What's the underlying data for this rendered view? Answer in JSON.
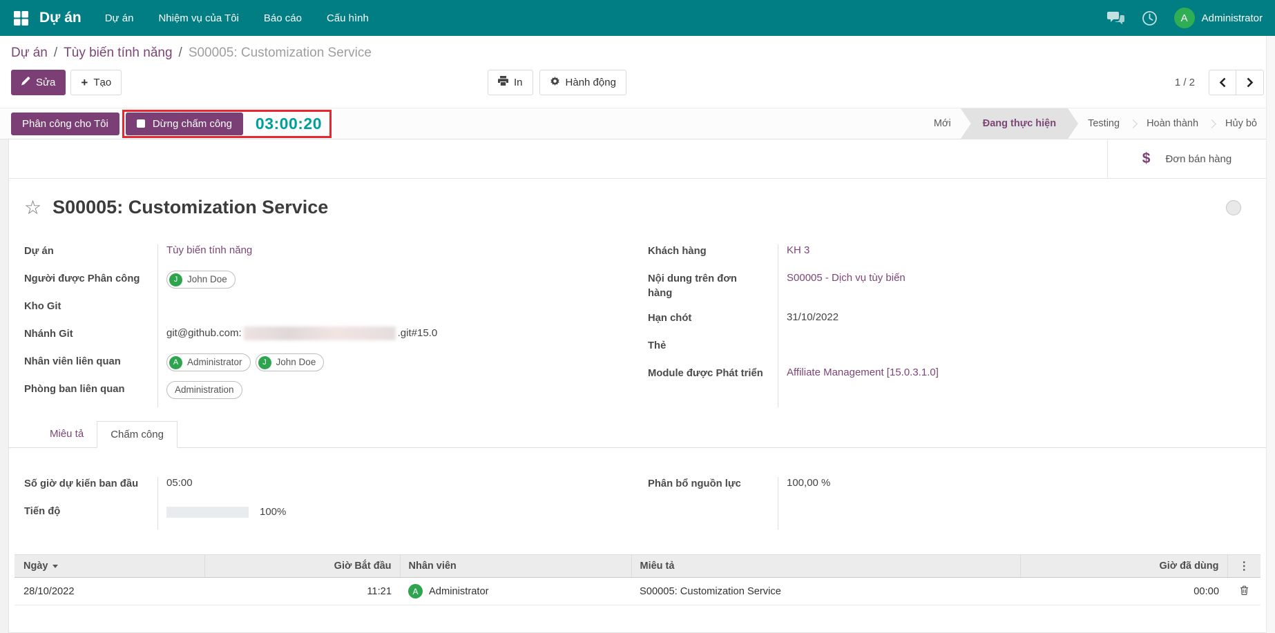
{
  "navbar": {
    "brand": "Dự án",
    "menus": [
      "Dự án",
      "Nhiệm vụ của Tôi",
      "Báo cáo",
      "Cấu hình"
    ],
    "user": {
      "initial": "A",
      "name": "Administrator"
    }
  },
  "breadcrumb": {
    "links": [
      "Dự án",
      "Tùy biến tính năng"
    ],
    "current": "S00005: Customization Service"
  },
  "control_panel": {
    "edit": "Sửa",
    "create": "Tạo",
    "print": "In",
    "action": "Hành động",
    "pager": "1 / 2"
  },
  "statusbar": {
    "assign_me": "Phân công cho Tôi",
    "stop_timer": "Dừng chấm công",
    "timer": "03:00:20",
    "stages": [
      {
        "label": "Mới",
        "active": false
      },
      {
        "label": "Đang thực hiện",
        "active": true
      },
      {
        "label": "Testing",
        "active": false
      },
      {
        "label": "Hoàn thành",
        "active": false
      },
      {
        "label": "Hủy bỏ",
        "active": false
      }
    ]
  },
  "smart_button": {
    "icon": "$",
    "label": "Đơn bán hàng"
  },
  "sheet": {
    "title": "S00005: Customization Service",
    "fields_left": [
      {
        "label": "Dự án",
        "type": "link",
        "value": "Tùy biến tính năng"
      },
      {
        "label": "Người được Phân công",
        "type": "tags",
        "tags": [
          {
            "initial": "J",
            "name": "John Doe"
          }
        ]
      },
      {
        "label": "Kho Git",
        "type": "redacted"
      },
      {
        "label": "Nhánh Git",
        "type": "redacted_inline",
        "prefix": "git@github.com:",
        "suffix": ".git#15.0"
      },
      {
        "label": "Nhân viên liên quan",
        "type": "tags",
        "tags": [
          {
            "initial": "A",
            "name": "Administrator"
          },
          {
            "initial": "J",
            "name": "John Doe"
          }
        ]
      },
      {
        "label": "Phòng ban liên quan",
        "type": "tags",
        "tags": [
          {
            "name": "Administration"
          }
        ]
      }
    ],
    "fields_right": [
      {
        "label": "Khách hàng",
        "type": "link",
        "value": "KH 3"
      },
      {
        "label": "Nội dung trên đơn hàng",
        "type": "link",
        "value": "S00005 - Dịch vụ tùy biến"
      },
      {
        "label": "Hạn chót",
        "type": "text",
        "value": "31/10/2022"
      },
      {
        "label": "Thẻ",
        "type": "empty",
        "value": ""
      },
      {
        "label": "Module được Phát triển",
        "type": "link",
        "value": "Affiliate Management [15.0.3.1.0]"
      }
    ],
    "tabs": [
      {
        "label": "Miêu tả",
        "active": false
      },
      {
        "label": "Chấm công",
        "active": true
      }
    ],
    "timesheet_panel": {
      "planned_hours_label": "Số giờ dự kiến ban đầu",
      "planned_hours": "05:00",
      "allocation_label": "Phân bổ nguồn lực",
      "allocation": "100,00 %",
      "progress_label": "Tiến độ",
      "progress_text": "100%",
      "progress_value": 100
    },
    "table": {
      "headers": [
        "Ngày",
        "Giờ Bắt đầu",
        "Nhân viên",
        "Miêu tả",
        "Giờ đã dùng"
      ],
      "rows": [
        {
          "date": "28/10/2022",
          "start": "11:21",
          "employee": {
            "initial": "A",
            "name": "Administrator"
          },
          "description": "S00005: Customization Service",
          "duration": "00:00"
        }
      ]
    }
  },
  "colors": {
    "navbar_bg": "#017e84",
    "accent_purple": "#7c3f75",
    "link_purple": "#7c4576",
    "timer_teal": "#00a09a",
    "annotation_red": "#e8262b",
    "avatar_green": "#2ea44f"
  }
}
